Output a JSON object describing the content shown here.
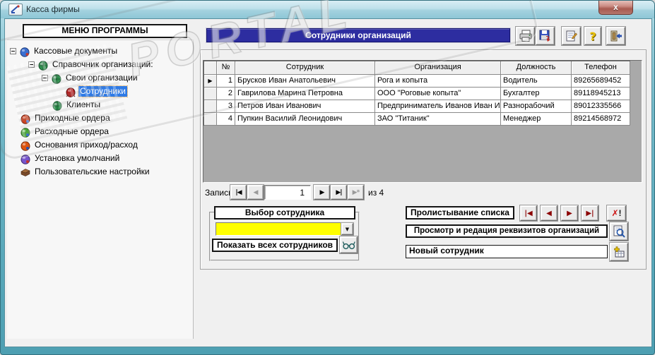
{
  "window": {
    "title": "Касса фирмы",
    "close_label": "x"
  },
  "watermark": {
    "text": "PORTAL",
    "tm": "TM"
  },
  "icons": {
    "collapse": "−",
    "first": "|◀",
    "prev": "◀",
    "next": "▶",
    "last": "▶|",
    "new_rec": "▶*",
    "marker": "▶",
    "dropdown": "▼",
    "delete_x": "✗",
    "delete_bang": "!",
    "help": "?"
  },
  "menu": {
    "header": "МЕНЮ ПРОГРАММЫ",
    "tree": [
      {
        "label": "Кассовые документы",
        "level": 0,
        "selected": false
      },
      {
        "label": "Справочник организаций:",
        "level": 1,
        "selected": false
      },
      {
        "label": "Свои организации",
        "level": 2,
        "selected": false
      },
      {
        "label": "Сотрудники",
        "level": 3,
        "selected": true
      },
      {
        "label": "Клиенты",
        "level": 2,
        "selected": false
      },
      {
        "label": "Приходные ордера",
        "level": 0,
        "selected": false
      },
      {
        "label": "Расходные ордера",
        "level": 0,
        "selected": false
      },
      {
        "label": "Основания приход/расход",
        "level": 0,
        "selected": false
      },
      {
        "label": "Установка умолчаний",
        "level": 0,
        "selected": false
      },
      {
        "label": "Пользовательские настройки",
        "level": 0,
        "selected": false
      }
    ]
  },
  "content": {
    "header": "Сотрудники организаций",
    "table": {
      "columns": [
        "№",
        "Сотрудник",
        "Организация",
        "Должность",
        "Телефон"
      ],
      "rows": [
        {
          "num": "1",
          "employee": "Брусков Иван Анатольевич",
          "org": "Рога и копыта",
          "position": "Водитель",
          "phone": "89265689452"
        },
        {
          "num": "2",
          "employee": "Гаврилова Марина Петровна",
          "org": "ООО \"Роговые копыта\"",
          "position": "Бухгалтер",
          "phone": "89118945213"
        },
        {
          "num": "3",
          "employee": "Петров Иван Иванович",
          "org": "Предприниматель Иванов Иван И",
          "position": "Разнорабочий",
          "phone": "89012335566"
        },
        {
          "num": "4",
          "employee": "Пупкин Василий Леонидович",
          "org": "ЗАО \"Титаник\"",
          "position": "Менеджер",
          "phone": "89214568972"
        }
      ]
    },
    "record_nav": {
      "label": "Запись:",
      "value": "1",
      "count_text": "из 4"
    },
    "selector": {
      "title": "Выбор сотрудника",
      "combo_value": "",
      "show_all": "Показать всех сотрудников"
    },
    "actions": {
      "browse_label": "Пролистывание списка",
      "review_label": "Просмотр и редация реквизитов организаций",
      "new_label": "Новый сотрудник"
    }
  },
  "colors": {
    "header_bg": "#2d2da0",
    "selection": "#2e7ae6",
    "combo_yellow": "#ffff00",
    "datasheet_gray": "#a9a9a9",
    "frame_teal": "#5aa9bb"
  }
}
